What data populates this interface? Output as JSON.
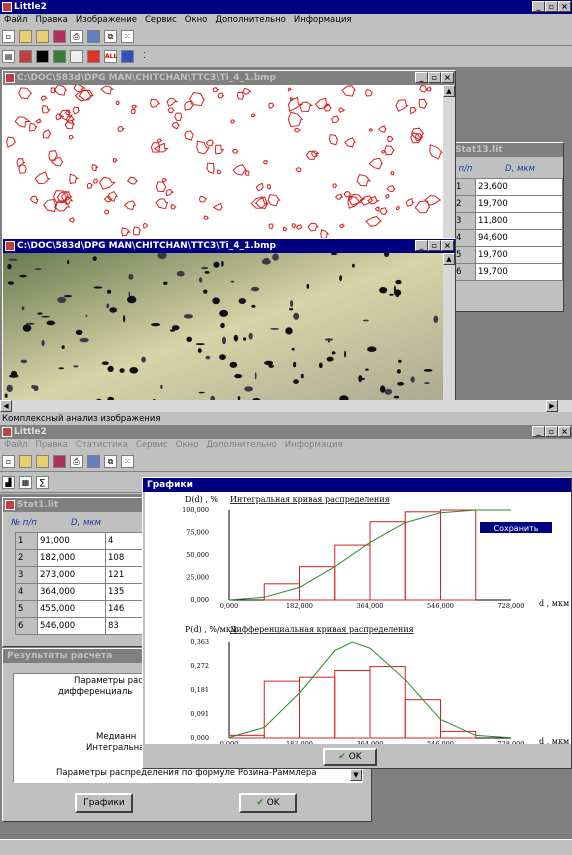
{
  "top_window": {
    "title": "Little2",
    "menu": [
      "Файл",
      "Правка",
      "Изображение",
      "Сервис",
      "Окно",
      "Дополнительно",
      "Информация"
    ]
  },
  "image_window": {
    "title": "C:\\DOC\\583d\\DPG MAN\\CHITCHAN\\TTC3\\Ti_4_1.bmp"
  },
  "photo_window": {
    "title": "C:\\DOC\\583d\\DPG MAN\\CHITCHAN\\TTC3\\Ti_4_1.bmp"
  },
  "stat13": {
    "title": "Stat13.lit",
    "headers": [
      "п/п",
      "D, мкм"
    ],
    "rows": [
      [
        "1",
        "23,600"
      ],
      [
        "2",
        "19,700"
      ],
      [
        "3",
        "11,800"
      ],
      [
        "4",
        "94,600"
      ],
      [
        "5",
        "19,700"
      ],
      [
        "6",
        "19,700"
      ]
    ]
  },
  "status_text": "Комплексный анализ изображения",
  "bottom_window": {
    "title": "Little2",
    "menu": [
      "Файл",
      "Правка",
      "Статистика",
      "Сервис",
      "Окно",
      "Дополнительно",
      "Информация"
    ]
  },
  "stat1": {
    "title": "Stat1.lit",
    "headers": [
      "№ п/п",
      "D, мкм"
    ],
    "rows": [
      [
        "1",
        "91,000",
        "4"
      ],
      [
        "2",
        "182,000",
        "108"
      ],
      [
        "3",
        "273,000",
        "121"
      ],
      [
        "4",
        "364,000",
        "135"
      ],
      [
        "5",
        "455,000",
        "146"
      ],
      [
        "6",
        "546,000",
        "83"
      ]
    ]
  },
  "results": {
    "title": "Результаты расчета",
    "lines": [
      "Параметры рас",
      "дифференциаль",
      "Р",
      "Медианн",
      "Интегральна",
      "Параметры распределения по формуле Розина-Раммлера"
    ],
    "graphs_button": "Графики",
    "ok_button": "OK"
  },
  "graphs": {
    "title": "Графики",
    "menu_item": "Сохранить",
    "ok_button": "OK"
  },
  "chart_data": [
    {
      "type": "bar",
      "title": "Интегральная кривая распределения",
      "ylabel": "D(d) , %",
      "xlabel": "d , мкм",
      "xticks": [
        "0,000",
        "182,000",
        "364,000",
        "546,000",
        "728,000"
      ],
      "yticks": [
        "0,000",
        "25,000",
        "50,000",
        "75,000",
        "100,000"
      ],
      "ylim": [
        0,
        100
      ],
      "x_edges": [
        91,
        182,
        273,
        364,
        455,
        546,
        637
      ],
      "values": [
        18,
        37,
        61,
        87,
        98,
        100
      ],
      "curve": [
        [
          0,
          0
        ],
        [
          91,
          3
        ],
        [
          182,
          14
        ],
        [
          273,
          37
        ],
        [
          364,
          64
        ],
        [
          455,
          86
        ],
        [
          546,
          97
        ],
        [
          637,
          100
        ],
        [
          728,
          100
        ]
      ]
    },
    {
      "type": "bar",
      "title": "Дифференциальная кривая распределения",
      "ylabel": "P(d) , %/мкм",
      "xlabel": "d , мкм",
      "xticks": [
        "0,000",
        "182,000",
        "364,000",
        "546,000",
        "728,000"
      ],
      "yticks": [
        "0,000",
        "0,091",
        "0,181",
        "0,272",
        "0,363"
      ],
      "ylim": [
        0,
        0.363
      ],
      "x_edges": [
        0,
        91,
        182,
        273,
        364,
        455,
        546,
        637
      ],
      "values": [
        0.01,
        0.215,
        0.23,
        0.255,
        0.27,
        0.145,
        0.025
      ],
      "curve": [
        [
          0,
          0.002
        ],
        [
          91,
          0.04
        ],
        [
          182,
          0.17
        ],
        [
          273,
          0.33
        ],
        [
          318,
          0.363
        ],
        [
          364,
          0.34
        ],
        [
          455,
          0.22
        ],
        [
          546,
          0.07
        ],
        [
          637,
          0.01
        ],
        [
          728,
          0.001
        ]
      ]
    }
  ]
}
